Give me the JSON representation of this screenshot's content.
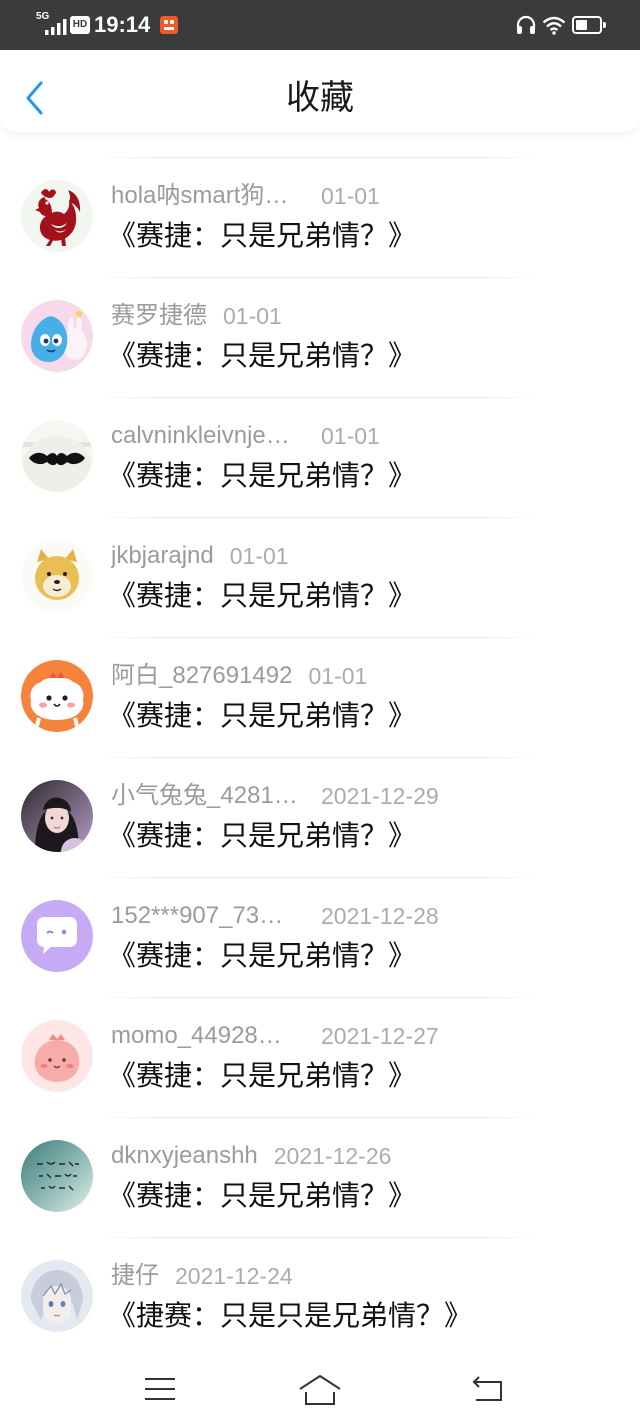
{
  "status_bar": {
    "network": "5G",
    "hd_badge": "HD",
    "time": "19:14",
    "battery_level": 0.5,
    "icons": [
      "cellular-signal-icon",
      "hd-icon",
      "app-notification-icon",
      "headphones-icon",
      "wifi-icon",
      "battery-icon"
    ]
  },
  "header": {
    "title": "收藏",
    "back_icon": "chevron-left-icon"
  },
  "colors": {
    "accent": "#1e9be9",
    "status_bar_bg": "#3b3b3b",
    "meta_text": "#9b9b9b",
    "title_text": "#111111"
  },
  "list": {
    "items": [
      {
        "avatar": "rooster-avatar",
        "user": "hola呐smart狗…",
        "date": "01-01",
        "title": "《赛捷：只是兄弟情？》"
      },
      {
        "avatar": "blue-creature-avatar",
        "user": "赛罗捷德",
        "date": "01-01",
        "title": "《赛捷：只是兄弟情？》"
      },
      {
        "avatar": "mustache-avatar",
        "user": "calvninkleivnje…",
        "date": "01-01",
        "title": "《赛捷：只是兄弟情？》"
      },
      {
        "avatar": "doge-avatar",
        "user": "jkbjarajnd",
        "date": "01-01",
        "title": "《赛捷：只是兄弟情？》"
      },
      {
        "avatar": "orange-cartoon-avatar",
        "user": "阿白_827691492",
        "date": "01-01",
        "title": "《赛捷：只是兄弟情？》"
      },
      {
        "avatar": "photo-avatar",
        "user": "小气兔兔_4281…",
        "date": "2021-12-29",
        "title": "《赛捷：只是兄弟情？》"
      },
      {
        "avatar": "chat-bubble-avatar",
        "user": "152***907_73…",
        "date": "2021-12-28",
        "title": "《赛捷：只是兄弟情？》"
      },
      {
        "avatar": "pink-blob-avatar",
        "user": "momo_44928…",
        "date": "2021-12-27",
        "title": "《赛捷：只是兄弟情？》"
      },
      {
        "avatar": "teal-handwriting-avatar",
        "user": "dknxyjeanshh",
        "date": "2021-12-26",
        "title": "《赛捷：只是兄弟情？》"
      },
      {
        "avatar": "anime-boy-avatar",
        "user": "捷仔",
        "date": "2021-12-24",
        "title": "《捷赛：只是只是兄弟情？》"
      }
    ]
  },
  "nav_bar": {
    "icons": [
      "menu-icon",
      "home-icon",
      "back-icon"
    ]
  }
}
